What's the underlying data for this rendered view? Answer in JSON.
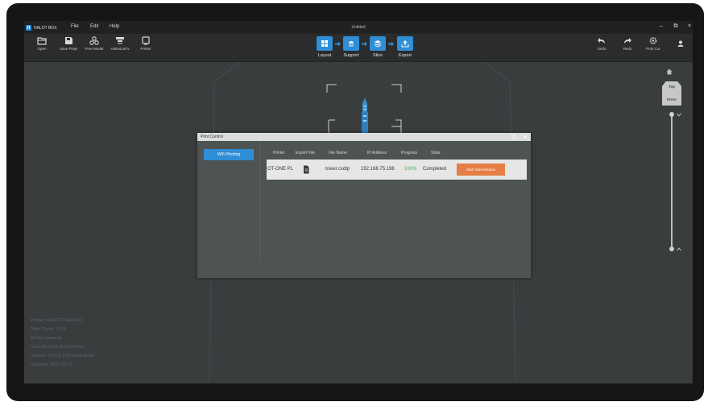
{
  "app": {
    "logo_text": "HALOT BOX",
    "window_title": "Untitled",
    "menu": [
      "File",
      "Edit",
      "Help"
    ],
    "window_controls": {
      "minimize": "–",
      "restore": "⧉",
      "close": "×"
    }
  },
  "toolbar": {
    "left": [
      {
        "label": "Open",
        "icon": "folder-open-icon"
      },
      {
        "label": "Save Proje",
        "icon": "save-project-icon"
      },
      {
        "label": "Free Model",
        "icon": "free-model-icon"
      },
      {
        "label": "Historical N",
        "icon": "historical-model-icon"
      },
      {
        "label": "Printer",
        "icon": "printer-icon"
      }
    ],
    "steps": [
      {
        "label": "Layout",
        "icon": "layout-icon"
      },
      {
        "label": "Support",
        "icon": "support-icon"
      },
      {
        "label": "Slice",
        "icon": "slice-icon"
      },
      {
        "label": "Export",
        "icon": "export-icon"
      }
    ],
    "right": [
      {
        "label": "Undo",
        "icon": "undo-icon"
      },
      {
        "label": "Redo",
        "icon": "redo-icon"
      },
      {
        "label": "Print Cor",
        "icon": "print-control-icon"
      },
      {
        "label": "",
        "icon": "user-icon"
      }
    ],
    "accent_color": "#2f8ed6"
  },
  "viewport": {
    "nav_cube": {
      "top": "Top",
      "front": "Front"
    },
    "info": [
      "Printer: HALOT-ONE PRO",
      "Total Floors: 2419",
      "Model: tower.stl",
      "Size: 54.0x54.0x120.00mm",
      "Version: V2.2.2.1191 Beta win64",
      "Updated: 2022-02-18"
    ]
  },
  "dialog": {
    "title": "Print Control",
    "wifi_button": "WiFi Printing",
    "columns": [
      "Printer",
      "Export File",
      "File Name",
      "IP Address",
      "Progress",
      "State"
    ],
    "row": {
      "printer": "OT-ONE PL",
      "export_icon": "file-icon",
      "file_name": "tower.cxdlp",
      "ip": "192.168.75.198",
      "progress": "100%",
      "state": "Completed",
      "action": "Start transmission"
    },
    "progress_color": "#4caf50",
    "action_color": "#e67e45"
  }
}
